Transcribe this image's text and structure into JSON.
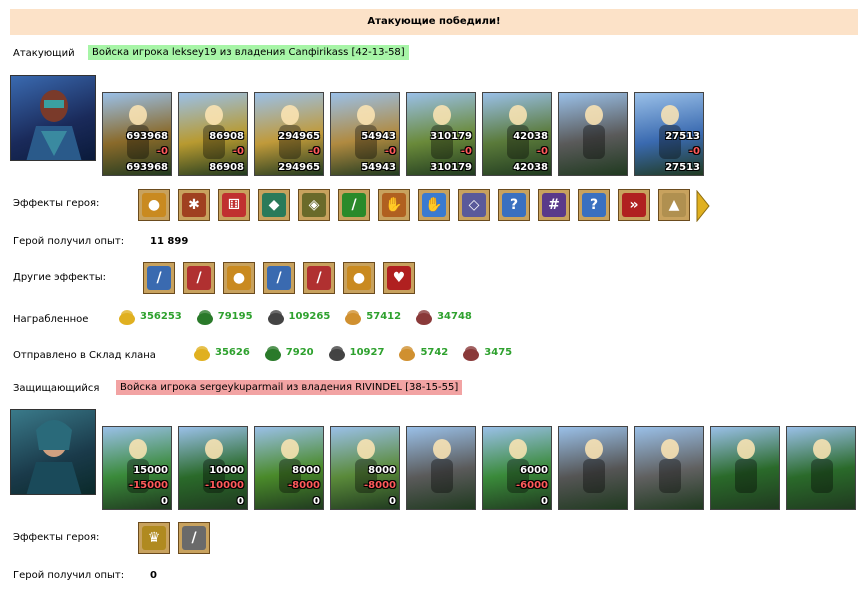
{
  "banner": "Атакующие победили!",
  "attacker": {
    "label": "Атакующий",
    "tag": "Войска игрока leksey19 из владения Canфirikass [42-13-58]",
    "units": [
      {
        "n1": "693968",
        "n2": "-0",
        "n3": "693968",
        "color": "#8a6a2a"
      },
      {
        "n1": "86908",
        "n2": "-0",
        "n3": "86908",
        "color": "#b89a30"
      },
      {
        "n1": "294965",
        "n2": "-0",
        "n3": "294965",
        "color": "#c09a3a"
      },
      {
        "n1": "54943",
        "n2": "-0",
        "n3": "54943",
        "color": "#b08a40"
      },
      {
        "n1": "310179",
        "n2": "-0",
        "n3": "310179",
        "color": "#6a8a3a"
      },
      {
        "n1": "42038",
        "n2": "-0",
        "n3": "42038",
        "color": "#5a7a3a"
      },
      {
        "n1": "",
        "n2": "",
        "n3": "",
        "color": "#5a5a5a"
      },
      {
        "n1": "27513",
        "n2": "-0",
        "n3": "27513",
        "color": "#3a6ab0"
      }
    ],
    "effects_label": "Эффекты героя:",
    "effects": [
      {
        "icon": "gold-coins-icon",
        "glyph": "●",
        "color": "#c98a20"
      },
      {
        "icon": "mechanism-icon",
        "glyph": "✱",
        "color": "#a04020"
      },
      {
        "icon": "dice-icon",
        "glyph": "⚅",
        "color": "#c03030"
      },
      {
        "icon": "shield-icon",
        "glyph": "◆",
        "color": "#2a7a5a"
      },
      {
        "icon": "shield-hand-icon",
        "glyph": "◈",
        "color": "#6a6a2a"
      },
      {
        "icon": "sword-icon",
        "glyph": "/",
        "color": "#2a8a2a"
      },
      {
        "icon": "handshake-icon",
        "glyph": "✋",
        "color": "#b06020"
      },
      {
        "icon": "hand-magic-icon",
        "glyph": "✋",
        "color": "#3a7ad0"
      },
      {
        "icon": "amulet-icon",
        "glyph": "◇",
        "color": "#5a5a9a"
      },
      {
        "icon": "question-icon",
        "glyph": "?",
        "color": "#3a70c0"
      },
      {
        "icon": "net-icon",
        "glyph": "#",
        "color": "#5a3a8a"
      },
      {
        "icon": "question-icon",
        "glyph": "?",
        "color": "#3a70c0"
      },
      {
        "icon": "arrows-icon",
        "glyph": "»",
        "color": "#b02020"
      },
      {
        "icon": "pyramid-icon",
        "glyph": "▲",
        "color": "#b09050"
      }
    ],
    "exp_label": "Герой получил опыт:",
    "exp_value": "11 899",
    "other_label": "Другие эффекты:",
    "other_effects": [
      {
        "icon": "sword-icon",
        "glyph": "/",
        "color": "#3a6ab0"
      },
      {
        "icon": "sword-shield-icon",
        "glyph": "/",
        "color": "#b03030"
      },
      {
        "icon": "gold-coins-icon",
        "glyph": "●",
        "color": "#c98a20"
      },
      {
        "icon": "sword-icon",
        "glyph": "/",
        "color": "#3a6ab0"
      },
      {
        "icon": "sword-shield-icon",
        "glyph": "/",
        "color": "#b03030"
      },
      {
        "icon": "gold-coins-icon",
        "glyph": "●",
        "color": "#c98a20"
      },
      {
        "icon": "heart-sword-icon",
        "glyph": "♥",
        "color": "#b02020"
      }
    ],
    "loot_label": "Награбленное",
    "loot": [
      {
        "icon": "gold-icon",
        "value": "356253",
        "color": "#e0b020"
      },
      {
        "icon": "wood-icon",
        "value": "79195",
        "color": "#2a7a2a"
      },
      {
        "icon": "ore-icon",
        "value": "109265",
        "color": "#444444"
      },
      {
        "icon": "wheat-icon",
        "value": "57412",
        "color": "#d09030"
      },
      {
        "icon": "stone-icon",
        "value": "34748",
        "color": "#8a3a3a"
      }
    ],
    "clan_label": "Отправлено в Склад клана",
    "clan": [
      {
        "icon": "gold-icon",
        "value": "35626",
        "color": "#e0b020"
      },
      {
        "icon": "wood-icon",
        "value": "7920",
        "color": "#2a7a2a"
      },
      {
        "icon": "ore-icon",
        "value": "10927",
        "color": "#444444"
      },
      {
        "icon": "wheat-icon",
        "value": "5742",
        "color": "#d09030"
      },
      {
        "icon": "stone-icon",
        "value": "3475",
        "color": "#8a3a3a"
      }
    ]
  },
  "defender": {
    "label": "Защищающийся",
    "tag": "Войска игрока sergeykuparmail из владения RIVINDEL [38-15-55]",
    "units": [
      {
        "n1": "15000",
        "n2": "-15000",
        "n3": "0",
        "color": "#3a8a3a"
      },
      {
        "n1": "10000",
        "n2": "-10000",
        "n3": "0",
        "color": "#2a6a2a"
      },
      {
        "n1": "8000",
        "n2": "-8000",
        "n3": "0",
        "color": "#4a8a2a"
      },
      {
        "n1": "8000",
        "n2": "-8000",
        "n3": "0",
        "color": "#5a8a3a"
      },
      {
        "n1": "",
        "n2": "",
        "n3": "",
        "color": "#5a5a5a"
      },
      {
        "n1": "6000",
        "n2": "-6000",
        "n3": "0",
        "color": "#3a8a3a"
      },
      {
        "n1": "",
        "n2": "",
        "n3": "",
        "color": "#555555"
      },
      {
        "n1": "",
        "n2": "",
        "n3": "",
        "color": "#606060"
      },
      {
        "n1": "",
        "n2": "",
        "n3": "",
        "color": "#2a6a2a"
      },
      {
        "n1": "",
        "n2": "",
        "n3": "",
        "color": "#2a6a2a"
      }
    ],
    "effects_label": "Эффекты героя:",
    "effects": [
      {
        "icon": "banner-icon",
        "glyph": "♛",
        "color": "#b08a20"
      },
      {
        "icon": "dagger-icon",
        "glyph": "/",
        "color": "#6a6a6a"
      }
    ],
    "exp_label": "Герой получил опыт:",
    "exp_value": "0"
  }
}
